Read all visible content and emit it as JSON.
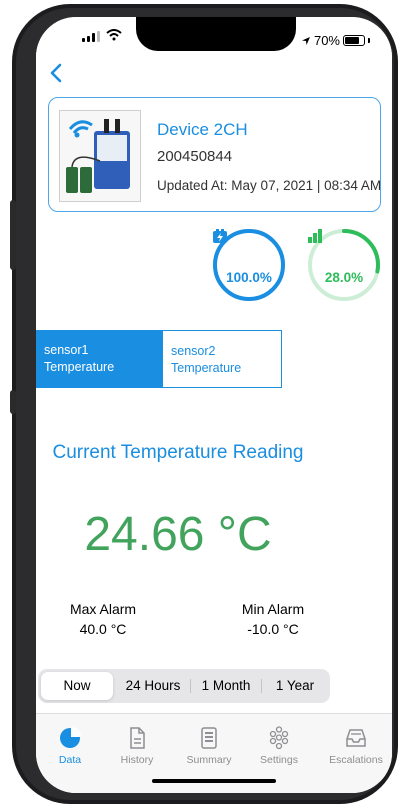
{
  "status_bar": {
    "battery_text": "70%"
  },
  "device": {
    "name": "Device 2CH",
    "serial": "200450844",
    "updated": "Updated At: May 07, 2021 | 08:34 AM"
  },
  "gauges": {
    "battery": {
      "text": "100.0%",
      "level": 100,
      "color": "#1a8ee0"
    },
    "signal": {
      "text": "28.0%",
      "level": 28,
      "color": "#2ebd5a"
    }
  },
  "sensor_tabs": [
    {
      "line1": "sensor1",
      "line2": "Temperature",
      "selected": true
    },
    {
      "line1": "sensor2",
      "line2": "Temperature",
      "selected": false
    }
  ],
  "reading": {
    "title": "Current Temperature Reading",
    "value": "24.66 °C",
    "max_label": "Max Alarm",
    "max_value": "40.0 °C",
    "min_label": "Min Alarm",
    "min_value": "-10.0 °C"
  },
  "ranges": [
    "Now",
    "24 Hours",
    "1 Month",
    "1 Year"
  ],
  "range_selected": "Now",
  "tabbar": [
    {
      "label": "Data",
      "icon": "pie-chart-icon",
      "active": true
    },
    {
      "label": "History",
      "icon": "document-icon",
      "active": false
    },
    {
      "label": "Summary",
      "icon": "summary-list-icon",
      "active": false
    },
    {
      "label": "Settings",
      "icon": "settings-dots-icon",
      "active": false
    },
    {
      "label": "Escalations",
      "icon": "inbox-tray-icon",
      "active": false
    }
  ],
  "colors": {
    "accent": "#1a8ee0",
    "temp_green": "#41a35c",
    "signal_green": "#2ebd5a"
  }
}
